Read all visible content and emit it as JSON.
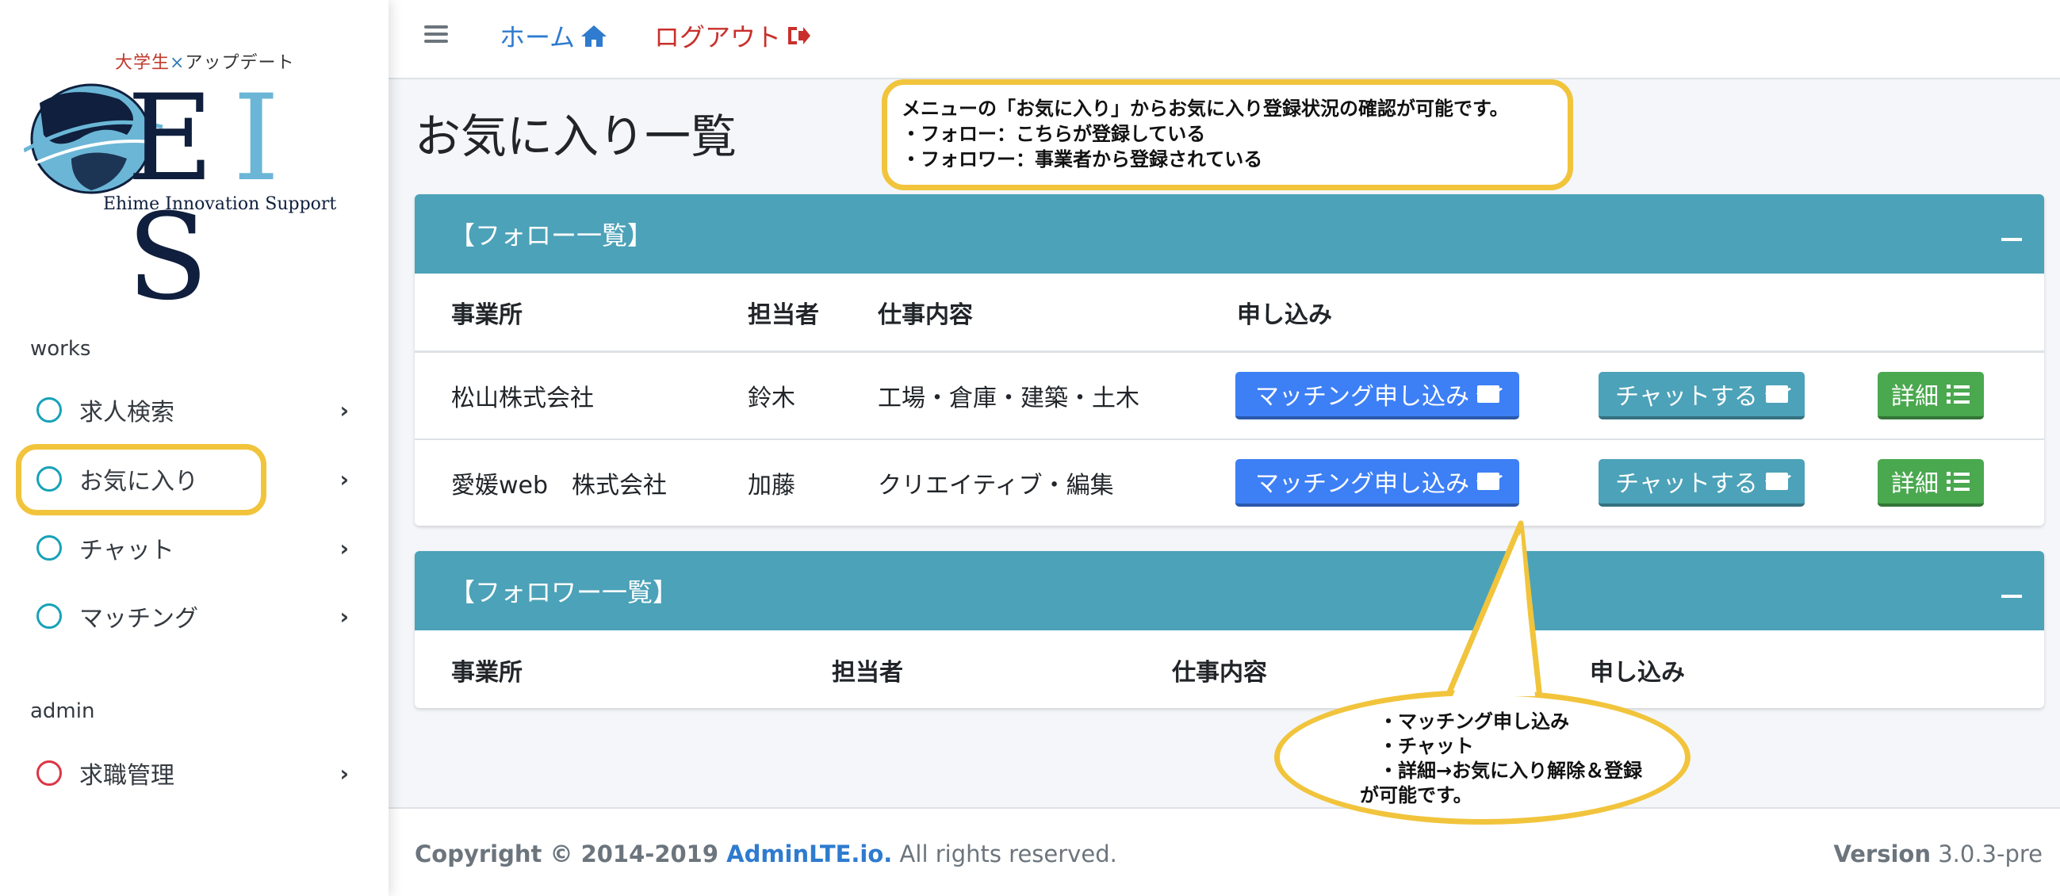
{
  "sidebar": {
    "brand": {
      "tag_part1": "大学生",
      "tag_part2": "×",
      "tag_part3": "アップデート",
      "word_e": "E",
      "word_i": "I",
      "word_s": "S",
      "subtitle": "Ehime Innovation Support"
    },
    "sections": [
      {
        "header": "works",
        "items": [
          {
            "label": "求人検索"
          },
          {
            "label": "お気に入り"
          },
          {
            "label": "チャット"
          },
          {
            "label": "マッチング"
          }
        ]
      },
      {
        "header": "admin",
        "items": [
          {
            "label": "求職管理"
          }
        ]
      }
    ]
  },
  "topnav": {
    "home": "ホーム",
    "logout": "ログアウト"
  },
  "page": {
    "title": "お気に入り一覧"
  },
  "callouts": {
    "top": [
      "メニューの「お気に入り」からお気に入り登録状況の確認が可能です。",
      "・フォロー：こちらが登録している",
      "・フォロワー：事業者から登録されている"
    ],
    "bottom": [
      "　・マッチング申し込み",
      "　・チャット",
      "　・詳細→お気に入り解除＆登録",
      "が可能です。"
    ]
  },
  "follow_card": {
    "title": "【フォロー一覧】",
    "headers": [
      "事業所",
      "担当者",
      "仕事内容",
      "申し込み"
    ],
    "rows": [
      {
        "office": "松山株式会社",
        "person": "鈴木",
        "job": "工場・倉庫・建築・土木"
      },
      {
        "office": "愛媛web　株式会社",
        "person": "加藤",
        "job": "クリエイティブ・編集"
      }
    ],
    "buttons": {
      "match": "マッチング申し込み",
      "chat": "チャットする",
      "detail": "詳細"
    }
  },
  "follower_card": {
    "title": "【フォロワー一覧】",
    "headers": [
      "事業所",
      "担当者",
      "仕事内容",
      "申し込み"
    ]
  },
  "footer": {
    "copyright_prefix": "Copyright © 2014-2019 ",
    "copyright_brand": "AdminLTE.io.",
    "copyright_suffix": " All rights reserved.",
    "version_label": "Version",
    "version_value": " 3.0.3-pre"
  },
  "colors": {
    "accent_teal": "#4ca2b8",
    "match_blue": "#3d7ff5",
    "detail_green": "#4aa84f",
    "highlight_yellow": "#f1c43c",
    "logout_red": "#c9302c",
    "link_blue": "#2e7bcf"
  },
  "icons": {
    "menu": "hamburger-icon",
    "home": "home-icon",
    "logout": "sign-out-icon",
    "mail": "envelope-icon",
    "list": "list-icon",
    "chevron": "chevron-right-icon",
    "circle": "circle-outline-icon"
  }
}
